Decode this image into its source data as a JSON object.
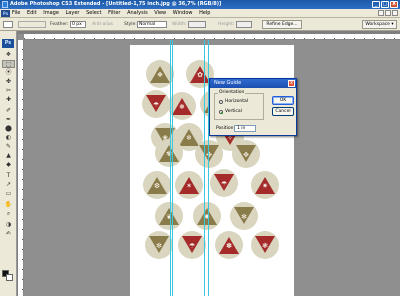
{
  "window": {
    "title": "Adobe Photoshop CS3 Extended - [Untitled-1,75 inch.jpg @ 36,7% (RGB/8)]",
    "app_icon": "Ps",
    "controls": {
      "minimize": "_",
      "maximize": "□",
      "close": "X"
    }
  },
  "menubar": {
    "badge": "Ps",
    "items": [
      "File",
      "Edit",
      "Image",
      "Layer",
      "Select",
      "Filter",
      "Analysis",
      "View",
      "Window",
      "Help"
    ]
  },
  "options": {
    "feather_label": "Feather:",
    "feather_value": "0 px",
    "antialias_label": "Anti-alias",
    "style_label": "Style:",
    "style_value": "Normal",
    "width_label": "Width:",
    "height_label": "Height:",
    "refine_label": "Refine Edge...",
    "workspace_label": "Workspace ▾"
  },
  "toolbox": {
    "logo": "Ps",
    "tools": [
      "❖",
      "⬚",
      "⦿",
      "✤",
      "✂",
      "✚",
      "✐",
      "✒",
      "⬤",
      "◐",
      "✎",
      "▲",
      "◆",
      "T",
      "↗",
      "▭",
      "✋",
      "⌕",
      "◑",
      "✍"
    ],
    "foreground_color": "#111111",
    "background_color": "#ffffff"
  },
  "canvas": {
    "guide_color": "#37c8df",
    "guide_count": 4,
    "medallion_count": 20,
    "colors": {
      "red": "#a52a2a",
      "olive": "#8a7c4a",
      "cream": "#f0ecde",
      "circle": "#d9d5bf"
    }
  },
  "dialog": {
    "title": "New Guide",
    "close_label": "x",
    "group_label": "Orientation",
    "orientation_options": [
      "Horizontal",
      "Vertical"
    ],
    "selected_orientation": "Vertical",
    "position_label": "Position:",
    "position_value": "1 in",
    "ok_label": "OK",
    "cancel_label": "Cancel"
  }
}
